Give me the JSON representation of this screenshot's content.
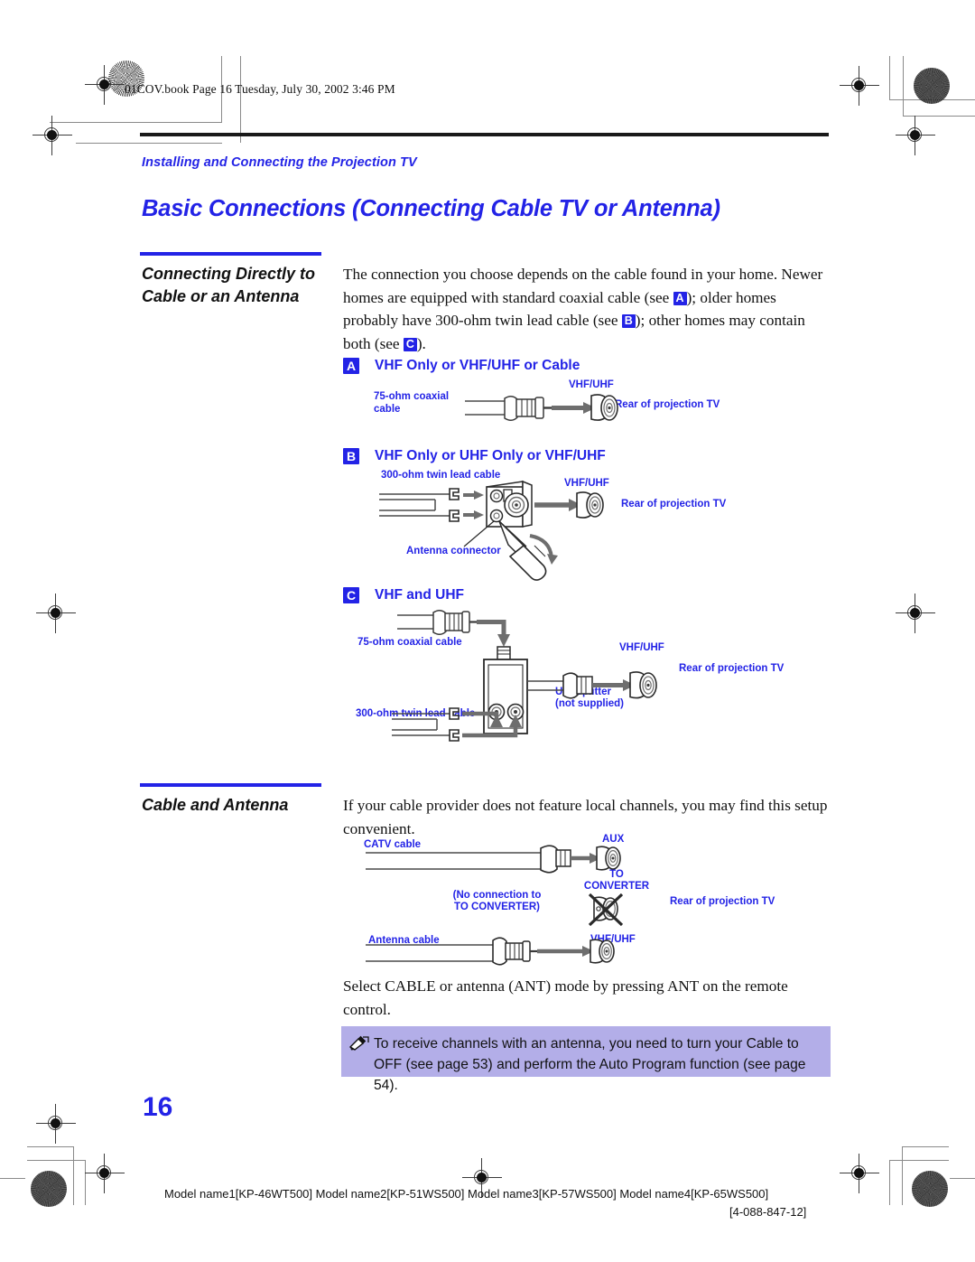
{
  "header": {
    "file_line": "01COV.book  Page 16  Tuesday, July 30, 2002  3:46 PM",
    "chapter": "Installing and Connecting the Projection TV",
    "title": "Basic Connections (Connecting Cable TV or Antenna)"
  },
  "section1": {
    "sidehead": "Connecting Directly to Cable or an Antenna",
    "body_1": "The connection you choose depends on the cable found in your home. Newer homes are equipped with standard coaxial cable (see ",
    "body_2": "); older homes probably have 300-ohm twin lead cable (see ",
    "body_3": "); other homes may contain both (see ",
    "body_4": ").",
    "chip_a": "A",
    "chip_b": "B",
    "chip_c": "C"
  },
  "diagram_a": {
    "chip": "A",
    "title": "VHF Only or VHF/UHF or Cable",
    "label_cable": "75-ohm coaxial cable",
    "label_vhfuhf": "VHF/UHF",
    "label_rear": "Rear of projection TV"
  },
  "diagram_b": {
    "chip": "B",
    "title": "VHF Only or UHF Only or VHF/UHF",
    "label_cable": "300-ohm twin lead cable",
    "label_vhfuhf": "VHF/UHF",
    "label_rear": "Rear of projection TV",
    "label_connector": "Antenna connector"
  },
  "diagram_c": {
    "chip": "C",
    "title": "VHF and UHF",
    "label_coax": "75-ohm coaxial cable",
    "label_twin": "300-ohm twin lead cable",
    "label_vhfuhf": "VHF/UHF",
    "label_rear": "Rear of projection TV",
    "label_splitter_1": "U/V Splitter",
    "label_splitter_2": "(not supplied)"
  },
  "section2": {
    "sidehead": "Cable and Antenna",
    "body": "If your cable provider does not feature local channels, you may find this setup convenient.",
    "closing": "Select CABLE or antenna (ANT) mode by pressing ANT on the remote control."
  },
  "diagram_d": {
    "label_catv": "CATV cable",
    "label_aux": "AUX",
    "label_to": "TO",
    "label_converter": "CONVERTER",
    "label_noconn_1": "(No connection to",
    "label_noconn_2": "TO CONVERTER)",
    "label_rear": "Rear of projection TV",
    "label_antenna": "Antenna cable",
    "label_vhfuhf": "VHF/UHF"
  },
  "note": {
    "icon": "pencil-note-icon",
    "text": "To receive channels with an antenna, you need to turn your Cable to OFF (see page 53) and perform the Auto Program function (see page 54)."
  },
  "footer": {
    "page_number": "16",
    "models": "Model name1[KP-46WT500] Model name2[KP-51WS500] Model name3[KP-57WS500] Model name4[KP-65WS500]",
    "doc_number": "[4-088-847-12]"
  },
  "colors": {
    "accent_blue": "#2323e6",
    "note_bg": "#b3aee8",
    "ink": "#111111",
    "diagram_gray": "#6e6e6e"
  }
}
